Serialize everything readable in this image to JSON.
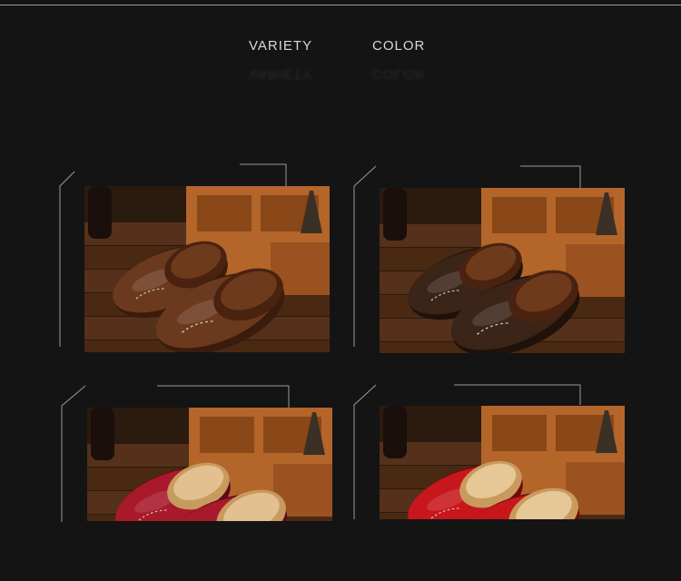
{
  "header": {
    "word_left": "VARIETY",
    "word_right": "COLOR"
  },
  "products": [
    {
      "name": "brown",
      "leather": "#6b3a1e",
      "leather_dark": "#3a1c0c",
      "fur": "#4a2210",
      "fur_light": "#6e3a1c"
    },
    {
      "name": "dark-brown",
      "leather": "#3b2418",
      "leather_dark": "#1e120b",
      "fur": "#4a2210",
      "fur_light": "#6e3a1c"
    },
    {
      "name": "wine-red",
      "leather": "#a8192b",
      "leather_dark": "#5d0c16",
      "fur": "#c79a5e",
      "fur_light": "#e2c08f"
    },
    {
      "name": "red",
      "leather": "#c8171c",
      "leather_dark": "#6f0b0e",
      "fur": "#c99a5e",
      "fur_light": "#e6c796"
    }
  ],
  "colors": {
    "background": "#141414",
    "line": "#9a9a9a",
    "heading": "#d8d8d8",
    "crate": "#b4652a",
    "floor": "#4b2a12"
  }
}
